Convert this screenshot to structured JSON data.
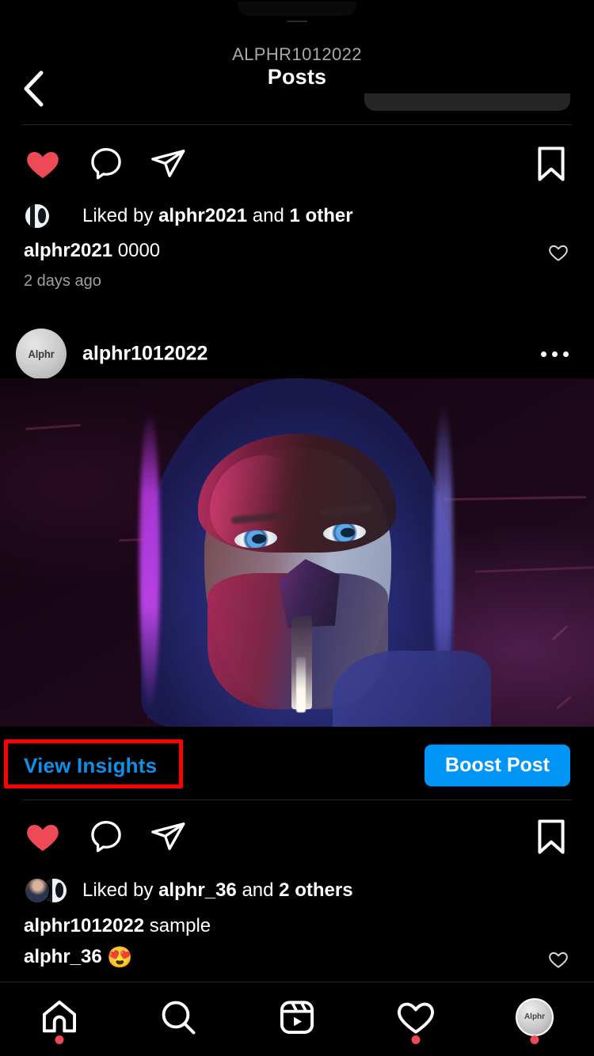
{
  "header": {
    "subtitle": "ALPHR1012022",
    "title": "Posts",
    "back_icon": "chevron-left-icon"
  },
  "post_top": {
    "actions": {
      "like_icon": "heart-filled-icon",
      "comment_icon": "comment-bubble-icon",
      "share_icon": "paper-plane-icon",
      "save_icon": "bookmark-icon"
    },
    "liked_by": {
      "prefix": "Liked by ",
      "user": "alphr2021",
      "middle": " and ",
      "others": "1 other"
    },
    "comment": {
      "username": "alphr2021",
      "text": "0000",
      "like_icon": "heart-outline-icon"
    },
    "timestamp": "2 days ago"
  },
  "post_main": {
    "author": "alphr1012022",
    "avatar_logo": "Alphr",
    "more_icon": "more-options-icon",
    "image_alt": "cyberpunk-portrait-hooded-figure-with-mask",
    "insights_label": "View Insights",
    "boost_label": "Boost Post",
    "highlight_color": "#ff0000",
    "link_color": "#0e90e8",
    "button_color": "#0095f6",
    "actions": {
      "like_icon": "heart-filled-icon",
      "comment_icon": "comment-bubble-icon",
      "share_icon": "paper-plane-icon",
      "save_icon": "bookmark-icon"
    },
    "liked_by": {
      "prefix": "Liked by ",
      "user": "alphr_36",
      "middle": " and ",
      "others": "2 others"
    },
    "caption": {
      "username": "alphr1012022",
      "text": "sample"
    },
    "comment": {
      "username": "alphr_36",
      "text": "😍",
      "like_icon": "heart-outline-icon"
    }
  },
  "bottom_nav": {
    "items": [
      {
        "name": "home",
        "icon": "home-icon",
        "badge": true
      },
      {
        "name": "search",
        "icon": "search-icon",
        "badge": false
      },
      {
        "name": "reels",
        "icon": "reels-icon",
        "badge": false
      },
      {
        "name": "activity",
        "icon": "heart-outline-icon",
        "badge": true
      },
      {
        "name": "profile",
        "icon": "profile-avatar-icon",
        "badge": true
      }
    ],
    "profile_logo": "Alphr",
    "badge_color": "#ed4956"
  },
  "colors": {
    "background": "#000000",
    "like_red": "#ed4956",
    "divider": "#262626",
    "secondary_text": "#a8a8a8"
  }
}
